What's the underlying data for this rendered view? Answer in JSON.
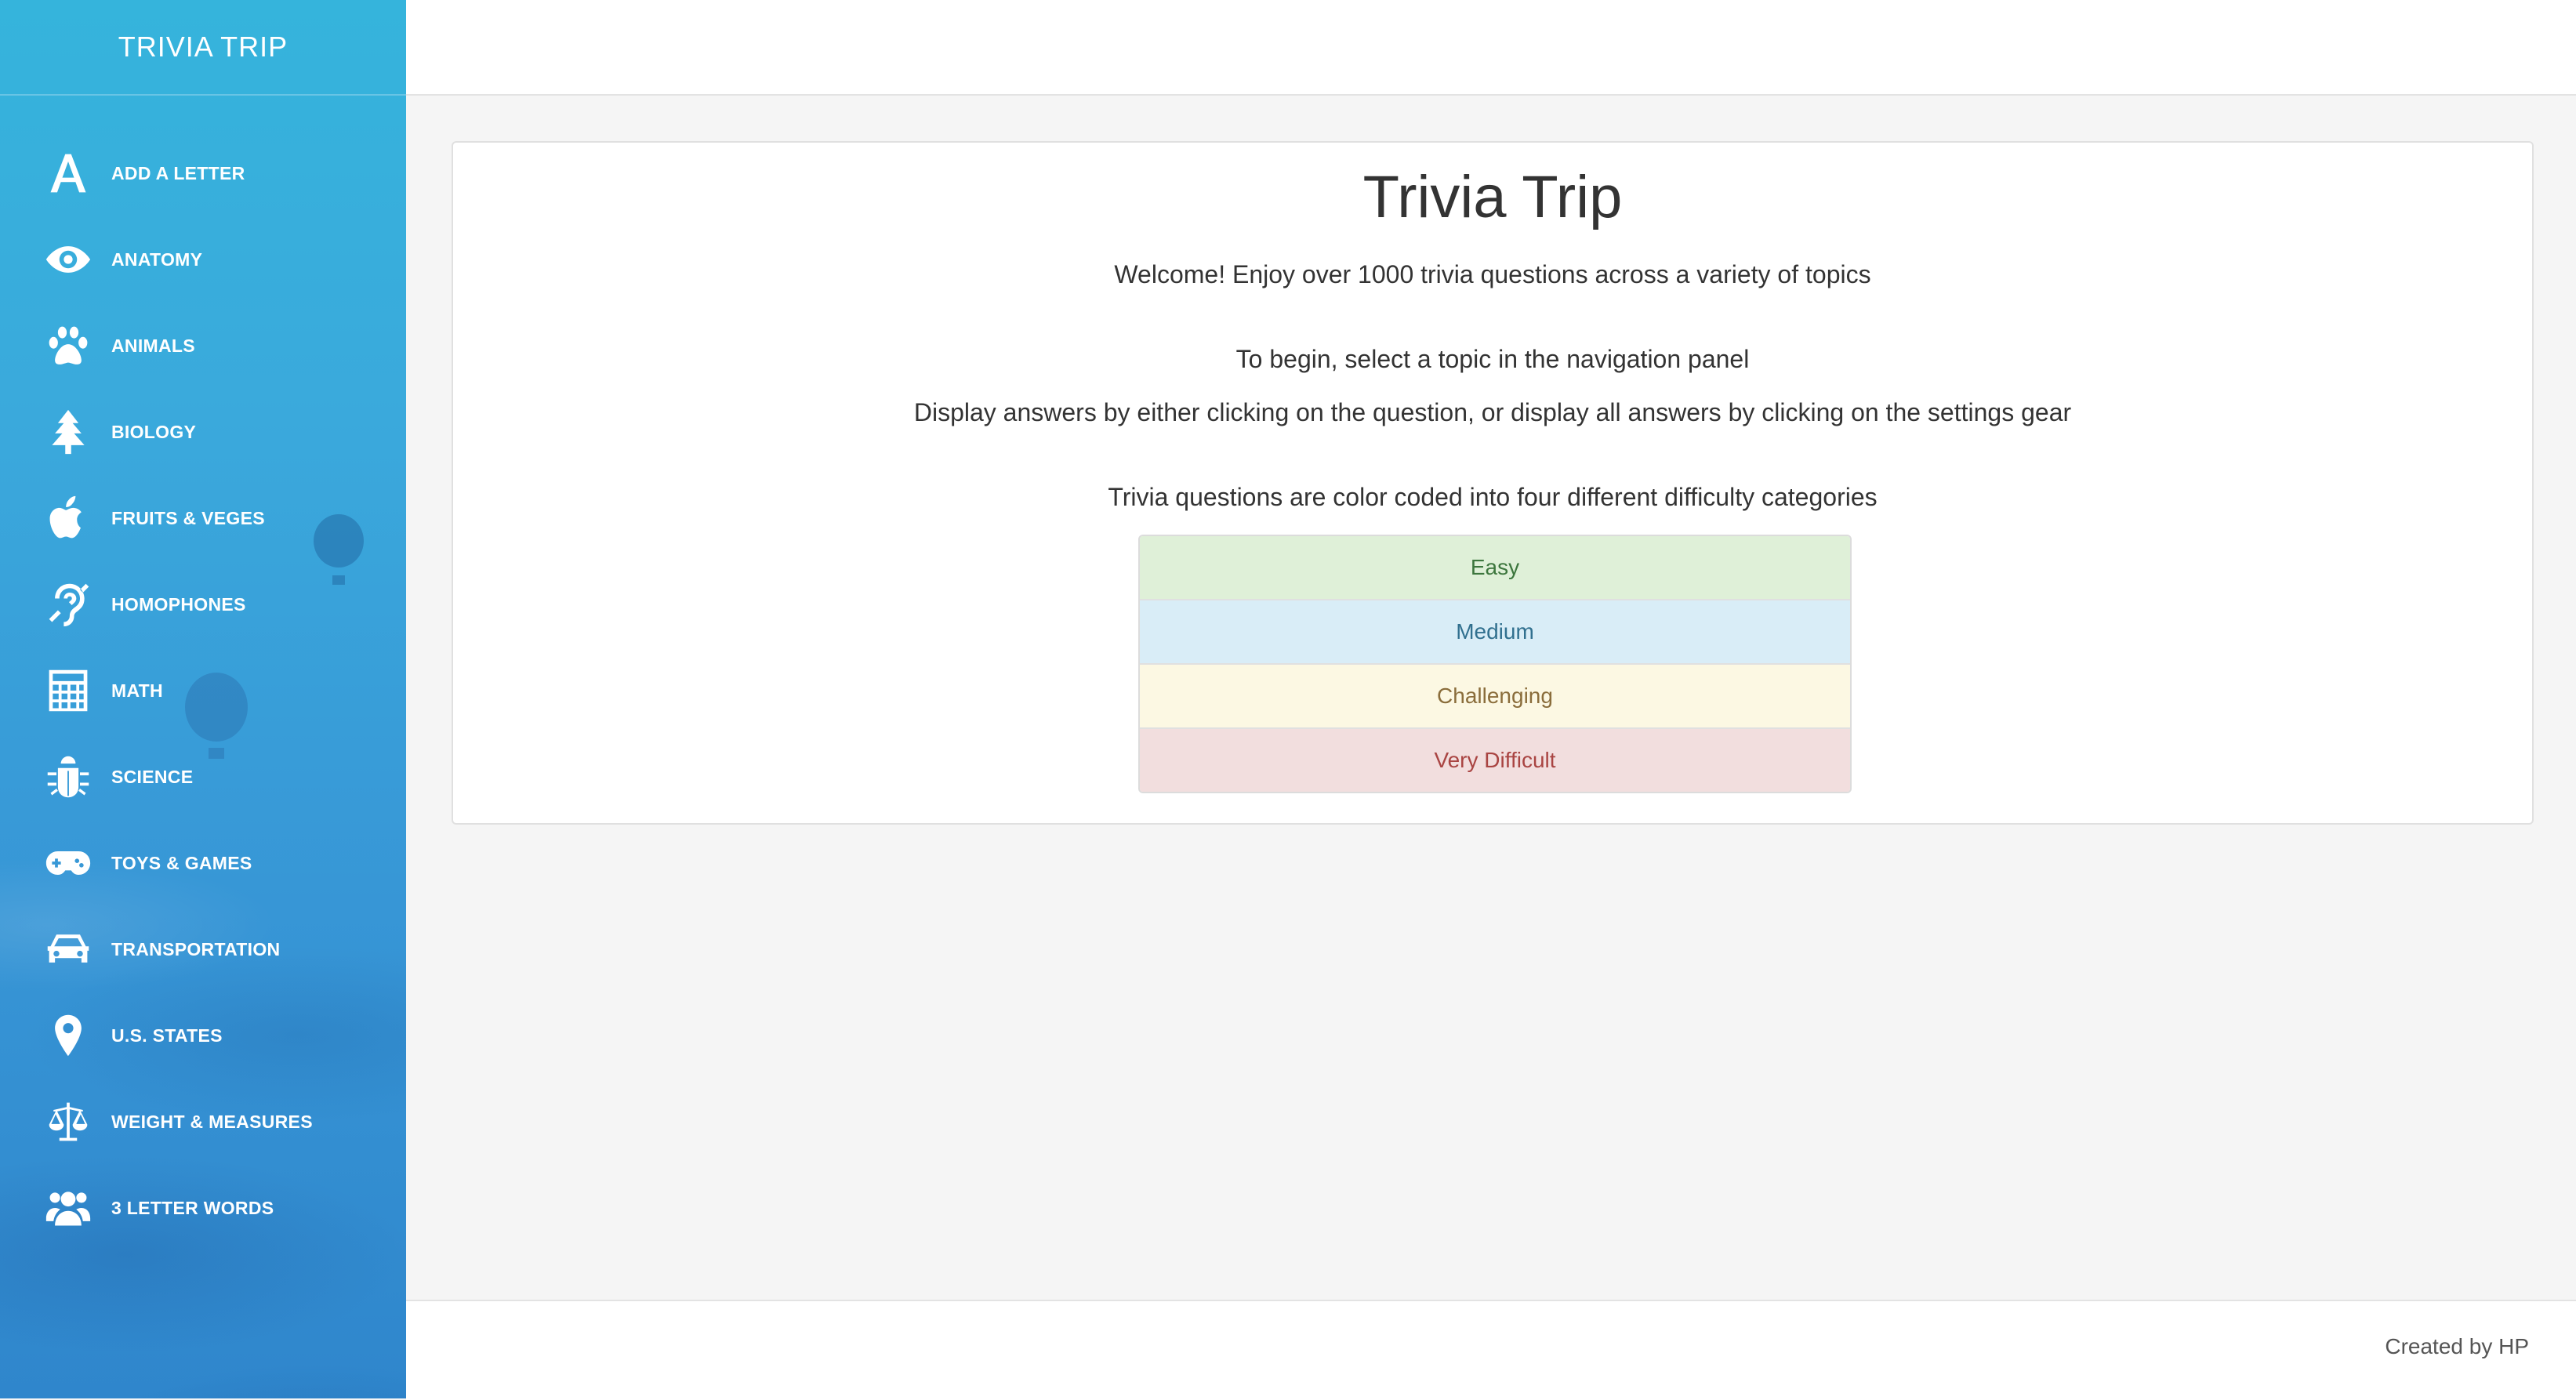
{
  "sidebar": {
    "brand": "TRIVIA TRIP",
    "items": [
      {
        "label": "ADD A LETTER",
        "icon": "letter-a-icon"
      },
      {
        "label": "ANATOMY",
        "icon": "eye-icon"
      },
      {
        "label": "ANIMALS",
        "icon": "paw-icon"
      },
      {
        "label": "BIOLOGY",
        "icon": "tree-icon"
      },
      {
        "label": "FRUITS & VEGES",
        "icon": "apple-icon"
      },
      {
        "label": "HOMOPHONES",
        "icon": "ear-icon"
      },
      {
        "label": "MATH",
        "icon": "calculator-icon"
      },
      {
        "label": "SCIENCE",
        "icon": "bug-icon"
      },
      {
        "label": "TOYS & GAMES",
        "icon": "gamepad-icon"
      },
      {
        "label": "TRANSPORTATION",
        "icon": "car-icon"
      },
      {
        "label": "U.S. STATES",
        "icon": "map-marker-icon"
      },
      {
        "label": "WEIGHT & MEASURES",
        "icon": "balance-scale-icon"
      },
      {
        "label": "3 LETTER WORDS",
        "icon": "users-icon"
      }
    ]
  },
  "main": {
    "title": "Trivia Trip",
    "welcome": "Welcome! Enjoy over 1000 trivia questions across a variety of topics",
    "begin": "To begin, select a topic in the navigation panel",
    "display": "Display answers by either clicking on the question, or display all answers by clicking on the settings gear",
    "color_coded": "Trivia questions are color coded into four different difficulty categories",
    "levels": [
      "Easy",
      "Medium",
      "Challenging",
      "Very Difficult"
    ]
  },
  "footer": {
    "credit": "Created by HP"
  },
  "colors": {
    "sidebar_top": "#35b4dc",
    "sidebar_bottom": "#2f86cc",
    "easy_bg": "#dff0d8",
    "medium_bg": "#d9edf7",
    "challenging_bg": "#fcf8e3",
    "very_difficult_bg": "#f2dede"
  }
}
